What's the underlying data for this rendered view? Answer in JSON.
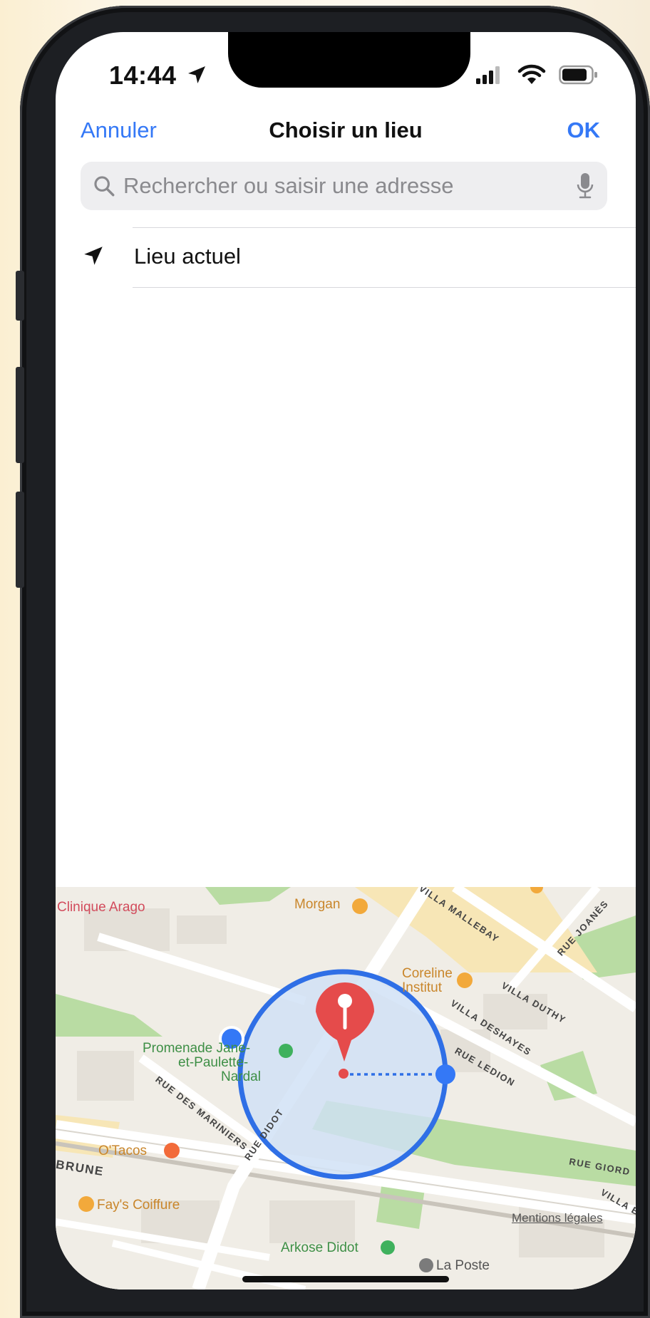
{
  "status_bar": {
    "time": "14:44"
  },
  "nav": {
    "cancel_label": "Annuler",
    "title": "Choisir un lieu",
    "ok_label": "OK"
  },
  "search": {
    "placeholder": "Rechercher ou saisir une adresse"
  },
  "list": {
    "current_location_label": "Lieu actuel"
  },
  "map": {
    "pois": {
      "clinique": "Clinique Arago",
      "morgan": "Morgan",
      "coreline": "Coreline",
      "coreline2": "Institut",
      "promenade1": "Promenade Jane-",
      "promenade2": "et-Paulette-",
      "promenade3": "Nardal",
      "otacos": "O'Tacos",
      "fays": "Fay's Coiffure",
      "arkose": "Arkose Didot",
      "laposte": "La Poste"
    },
    "streets": {
      "mallebay": "VILLA MALLEBAY",
      "joanes": "RUE JOANÈS",
      "duthy": "VILLA DUTHY",
      "deshayes": "VILLA DESHAYES",
      "ledion": "RUE LEDION",
      "mariniers": "RUE DES MARINIERS",
      "didot": "RUE DIDOT",
      "brune": "BRUNE",
      "giordano": "RUE GIORD",
      "villa_b": "VILLA B"
    },
    "legal_label": "Mentions légales"
  },
  "colors": {
    "accent": "#3478f6",
    "pin": "#e54b4b",
    "radius_fill": "#cfe0f5",
    "park": "#b9dca3"
  }
}
